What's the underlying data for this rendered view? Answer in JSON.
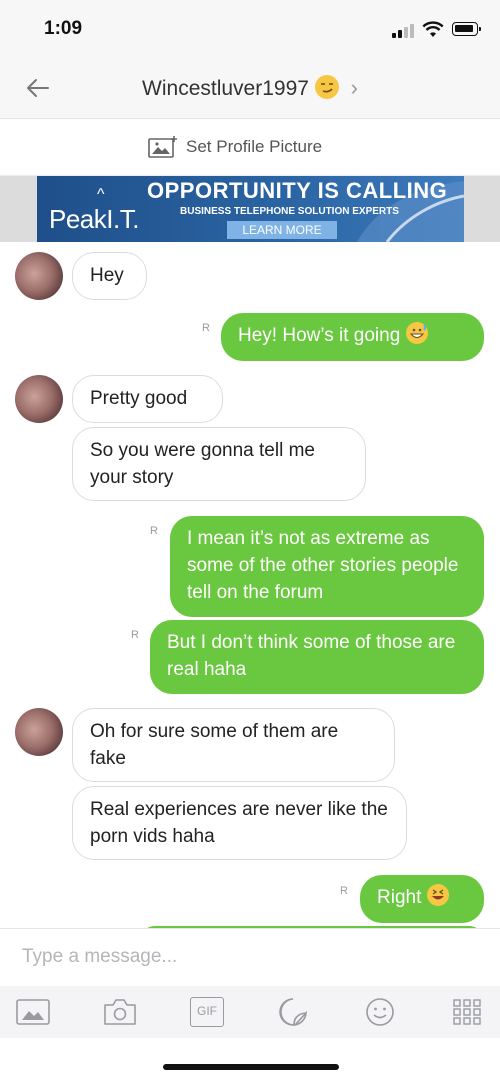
{
  "status": {
    "time": "1:09"
  },
  "nav": {
    "title": "Wincestluver1997",
    "chevron": "›"
  },
  "profile": {
    "label": "Set Profile Picture"
  },
  "ad": {
    "logo": "PeakI.T.",
    "headline": "OPPORTUNITY IS CALLING",
    "subline": "BUSINESS TELEPHONE SOLUTION EXPERTS",
    "button": "LEARN MORE"
  },
  "messages": [
    {
      "dir": "in",
      "text": "Hey"
    },
    {
      "dir": "out",
      "text": "Hey! How’s it going",
      "emoji": "grin-sweat-emoji"
    },
    {
      "dir": "in",
      "text": "Pretty good"
    },
    {
      "dir": "in",
      "text": "So you were gonna tell me your story"
    },
    {
      "dir": "out",
      "text": "I mean it’s not as extreme as some of the other stories people tell on the forum"
    },
    {
      "dir": "out",
      "text": "But I don’t think some of those are real haha"
    },
    {
      "dir": "in",
      "text": "Oh for sure some of them are fake"
    },
    {
      "dir": "in",
      "text": "Real experiences are never like the porn vids haha"
    },
    {
      "dir": "out",
      "text": "Right",
      "emoji": "laughing-emoji"
    }
  ],
  "read_receipt": "R",
  "input": {
    "placeholder": "Type a message..."
  },
  "toolbar": {
    "gif_label": "GIF"
  },
  "colors": {
    "outgoing": "#6ac840",
    "incoming_border": "#dcdce0"
  }
}
